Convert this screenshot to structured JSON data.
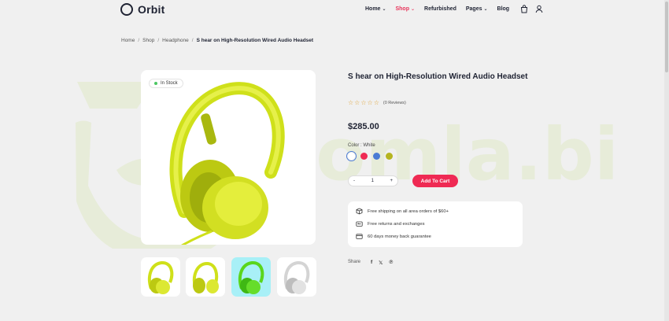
{
  "brand": {
    "name": "Orbit"
  },
  "nav": [
    {
      "label": "Home",
      "caret": "⌄",
      "active": false
    },
    {
      "label": "Shop",
      "caret": "⌄",
      "active": true
    },
    {
      "label": "Refurbished",
      "caret": "",
      "active": false
    },
    {
      "label": "Pages",
      "caret": "⌄",
      "active": false
    },
    {
      "label": "Blog",
      "caret": "",
      "active": false
    }
  ],
  "header_icons": [
    "cart-icon",
    "user-icon"
  ],
  "breadcrumb": {
    "items": [
      "Home",
      "Shop",
      "Headphone"
    ],
    "separator": "/",
    "current": "S hear on High-Resolution Wired Audio Headset"
  },
  "watermark": {
    "text": "oomla.bid"
  },
  "product": {
    "stock": "In Stock",
    "title": "S hear on High-Resolution Wired Audio Headset",
    "rating_stars": [
      "☆",
      "☆",
      "☆",
      "☆",
      "☆"
    ],
    "reviews": "(0 Reviews)",
    "price": "$285.00",
    "color_label": "Color : White",
    "colors": [
      {
        "name": "White",
        "hex": "#ffffff",
        "selected": true
      },
      {
        "name": "Red",
        "hex": "#ef2a53",
        "selected": false
      },
      {
        "name": "Blue",
        "hex": "#4a7bd4",
        "selected": false
      },
      {
        "name": "Olive",
        "hex": "#b5b520",
        "selected": false
      }
    ],
    "quantity": {
      "minus": "-",
      "value": "1",
      "plus": "+"
    },
    "add_to_cart": "Add To Cart",
    "features": [
      {
        "icon": "box-icon",
        "text": "Free shipping on all area orders of $60+"
      },
      {
        "icon": "return-icon",
        "text": "Free returns and exchanges"
      },
      {
        "icon": "wallet-icon",
        "text": "60 days money back guarantee"
      }
    ],
    "share_label": "Share",
    "share_icons": [
      {
        "icon": "facebook-icon",
        "glyph": "f"
      },
      {
        "icon": "x-icon",
        "glyph": "𝕏"
      },
      {
        "icon": "pinterest-icon",
        "glyph": "℗"
      }
    ],
    "thumbnails": [
      {
        "variant": "yellow",
        "selected": false
      },
      {
        "variant": "yellow",
        "selected": false
      },
      {
        "variant": "green",
        "selected": true
      },
      {
        "variant": "silver",
        "selected": false
      }
    ]
  },
  "colors": {
    "accent": "#ef2a53",
    "text": "#1f2333",
    "background": "#f0f0f0",
    "stock_dot": "#4cc763"
  }
}
